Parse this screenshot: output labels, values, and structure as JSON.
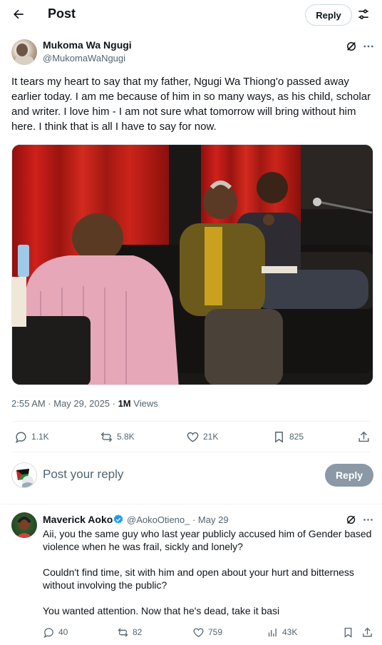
{
  "header": {
    "title": "Post",
    "reply_label": "Reply"
  },
  "post": {
    "author_name": "Mukoma Wa Ngugi",
    "author_handle": "@MukomaWaNgugi",
    "text": "It tears my heart to say that my father, Ngugi Wa Thiong'o passed away earlier today. I am me because of him in so many ways, as his child, scholar and writer. I love him - I am not sure what tomorrow will bring without him here.  I think that is all I have to say for now.",
    "timestamp": "2:55 AM · May 29, 2025 · ",
    "views_count": "1M",
    "views_label": "Views",
    "replies": "1.1K",
    "reposts": "5.8K",
    "likes": "21K",
    "bookmarks": "825"
  },
  "composer": {
    "placeholder": "Post your reply",
    "button_label": "Reply"
  },
  "reply": {
    "author_name": "Maverick Aoko",
    "author_handle": "@AokoOtieno_ · May 29",
    "line1": "Aii, you the same guy who last year publicly accused him of Gender based violence when he was frail, sickly and lonely?",
    "line2": "Couldn't find time, sit with him and open about your hurt and bitterness without involving the public?",
    "line3": "You wanted attention. Now that he's dead, take it basi",
    "replies": "40",
    "reposts": "82",
    "likes": "759",
    "views": "43K"
  },
  "colors": {
    "text": "#0f1419",
    "secondary": "#536471",
    "verified": "#1d9bf0",
    "reply_disabled": "#8b98a5"
  }
}
